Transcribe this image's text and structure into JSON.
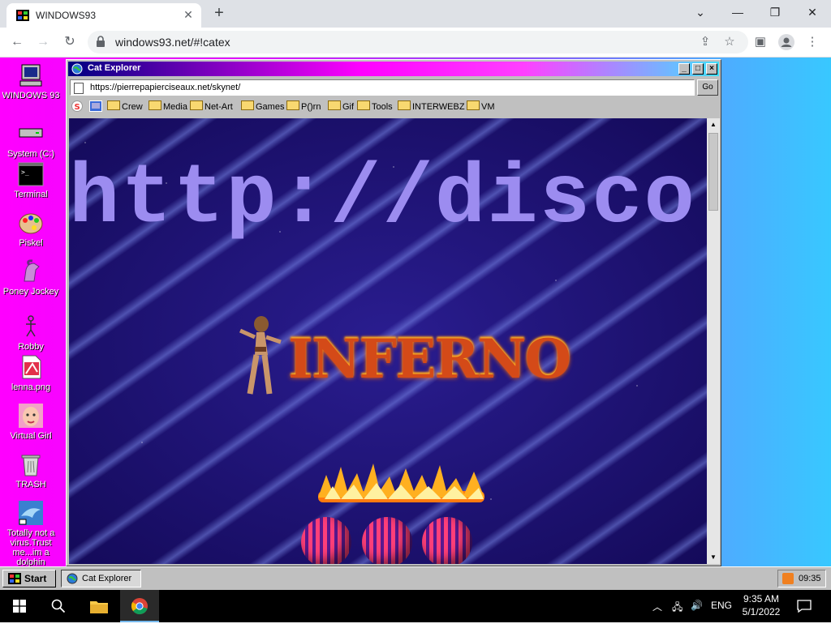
{
  "browser": {
    "tab_title": "WINDOWS93",
    "address": "windows93.net/#!catex",
    "window_controls": [
      "minimize-icon",
      "restore-icon",
      "close-icon"
    ]
  },
  "desktop": {
    "icons": [
      {
        "label": "WINDOWS 93",
        "icon": "computer-icon"
      },
      {
        "label": "System (C:)",
        "icon": "drive-icon"
      },
      {
        "label": "Terminal",
        "icon": "terminal-icon"
      },
      {
        "label": "Piskel",
        "icon": "palette-icon"
      },
      {
        "label": "Poney Jockey",
        "icon": "pony-icon"
      },
      {
        "label": "Robby",
        "icon": "stickman-icon"
      },
      {
        "label": "lenna.png",
        "icon": "image-file-icon"
      },
      {
        "label": "Virtual Girl",
        "icon": "face-icon"
      },
      {
        "label": "TRASH",
        "icon": "trash-icon"
      },
      {
        "label": "Totally not a virus.Trust me...im a dolphin",
        "icon": "dolphin-icon"
      }
    ]
  },
  "cat_explorer": {
    "title": "Cat Explorer",
    "url": "https://pierrepapierciseaux.net/skynet/",
    "go_label": "Go",
    "bookmarks": [
      "Crew",
      "Media",
      "Net-Art",
      "Games",
      "P()rn",
      "Gif",
      "Tools",
      "INTERWEBZ",
      "VM"
    ],
    "page": {
      "big_text": "http://disco",
      "logo_text": "INFERNO"
    }
  },
  "w93_taskbar": {
    "start_label": "Start",
    "task_label": "Cat Explorer",
    "tray_time": "09:35"
  },
  "win10_taskbar": {
    "time": "9:35 AM",
    "date": "5/1/2022",
    "lang": "ENG"
  },
  "colors": {
    "desktop_gradient": [
      "#ff00ff",
      "#9050ff",
      "#38c8ff"
    ],
    "win93_gray": "#c0c0c0",
    "page_bg": "#1a1060",
    "big_text": "#9c8cf0"
  }
}
